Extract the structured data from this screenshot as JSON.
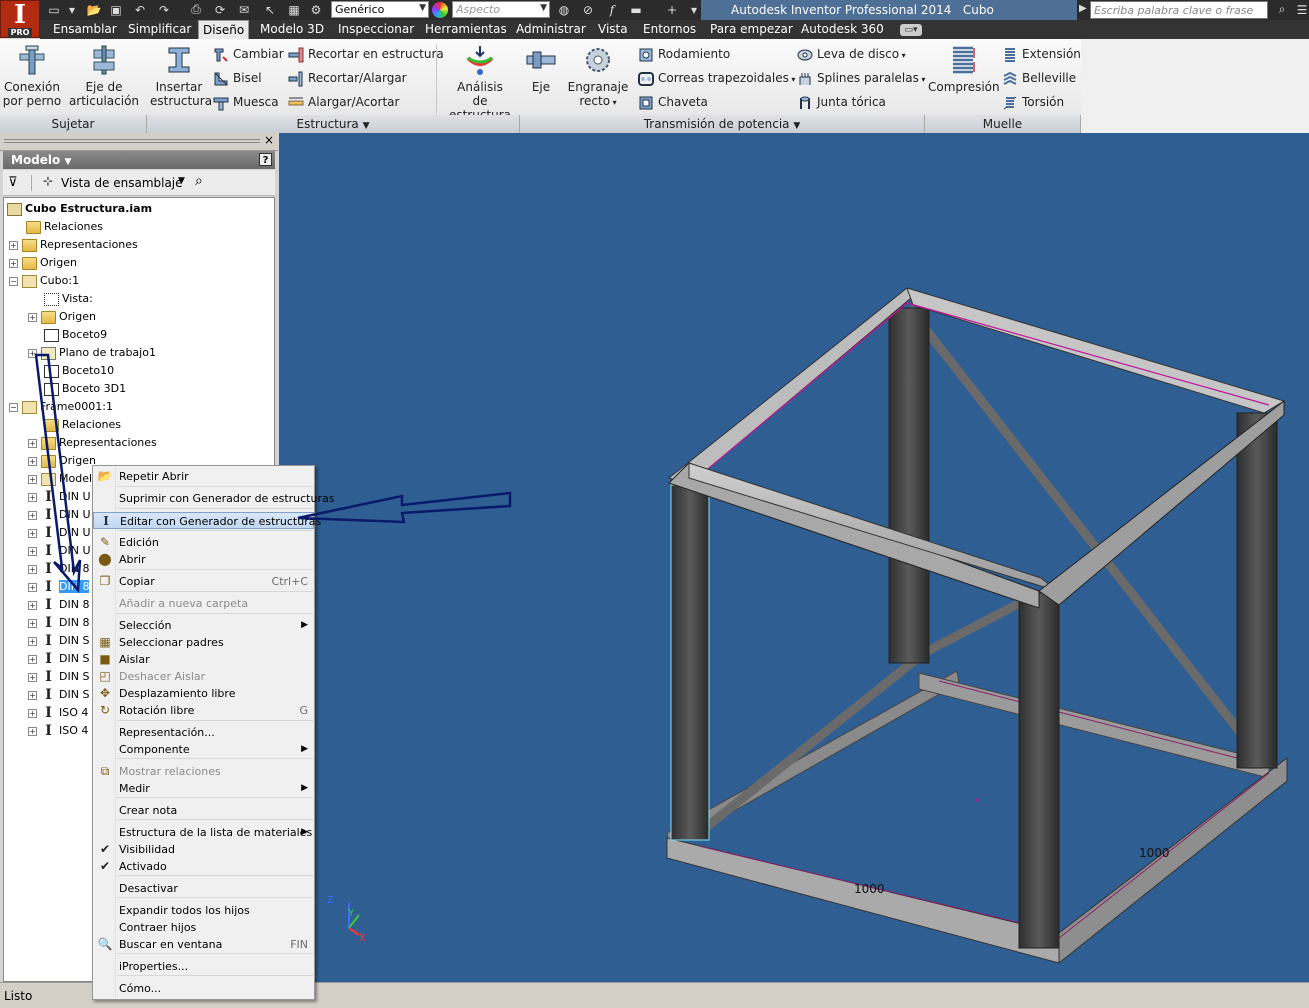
{
  "app": {
    "logo_label": "PRO",
    "window_title": "Autodesk Inventor Professional 2014",
    "document_title": "Cubo Estructura.iam",
    "search_placeholder": "Escriba palabra clave o frase"
  },
  "quick_access": {
    "material_combo": "Genérico",
    "appearance_combo": "Aspecto"
  },
  "menu": {
    "items": [
      "Ensamblar",
      "Simplificar",
      "Diseño",
      "Modelo 3D",
      "Inspeccionar",
      "Herramientas",
      "Administrar",
      "Vista",
      "Entornos",
      "Para empezar",
      "Autodesk 360"
    ],
    "active": "Diseño"
  },
  "ribbon": {
    "panels": {
      "sujetar": "Sujetar",
      "estructura": "Estructura",
      "transmision": "Transmisión de potencia",
      "muelle": "Muelle"
    },
    "sujetar": {
      "conexion_l1": "Conexión",
      "conexion_l2": "por perno",
      "eje_l1": "Eje de",
      "eje_l2": "articulación"
    },
    "estructura": {
      "insertar_l1": "Insertar",
      "insertar_l2": "estructura",
      "cambiar": "Cambiar",
      "bisel": "Bisel",
      "muesca": "Muesca",
      "recortar_estructura": "Recortar en estructura",
      "recortar_alargar": "Recortar/Alargar",
      "alargar_acortar": "Alargar/Acortar",
      "analisis_l1": "Análisis",
      "analisis_l2": "de estructura"
    },
    "transmision": {
      "eje": "Eje",
      "engranaje_l1": "Engranaje",
      "engranaje_l2": "recto",
      "rodamiento": "Rodamiento",
      "correas": "Correas trapezoidales",
      "chaveta": "Chaveta",
      "leva": "Leva de disco",
      "splines": "Splines paralelas",
      "junta": "Junta tórica"
    },
    "muelle": {
      "compresion": "Compresión",
      "extension": "Extensión",
      "belleville": "Belleville",
      "torsion": "Torsión"
    }
  },
  "browser": {
    "title": "Modelo",
    "help": "?",
    "view_combo": "Vista de ensamblaje",
    "tree": [
      {
        "label": "Cubo Estructura.iam"
      },
      {
        "label": "Relaciones"
      },
      {
        "label": "Representaciones"
      },
      {
        "label": "Origen"
      },
      {
        "label": "Cubo:1"
      },
      {
        "label": "Vista:"
      },
      {
        "label": "Origen"
      },
      {
        "label": "Boceto9"
      },
      {
        "label": "Plano de trabajo1"
      },
      {
        "label": "Boceto10"
      },
      {
        "label": "Boceto 3D1"
      },
      {
        "label": "Frame0001:1"
      },
      {
        "label": "Relaciones"
      },
      {
        "label": "Representaciones"
      },
      {
        "label": "Origen"
      },
      {
        "label": "Model"
      },
      {
        "label": "DIN U"
      },
      {
        "label": "DIN U"
      },
      {
        "label": "DIN U"
      },
      {
        "label": "DIN U"
      },
      {
        "label": "DIN 8"
      },
      {
        "label": "DIN 8"
      },
      {
        "label": "DIN 8"
      },
      {
        "label": "DIN 8"
      },
      {
        "label": "DIN S"
      },
      {
        "label": "DIN S"
      },
      {
        "label": "DIN S"
      },
      {
        "label": "DIN S"
      },
      {
        "label": "ISO 4"
      },
      {
        "label": "ISO 4"
      }
    ]
  },
  "context_menu": {
    "items": [
      {
        "label": "Repetir Abrir"
      },
      {
        "label": "Suprimir con Generador de estructuras"
      },
      {
        "label": "Editar con Generador de estructuras"
      },
      {
        "label": "Edición"
      },
      {
        "label": "Abrir"
      },
      {
        "label": "Copiar",
        "shortcut": "Ctrl+C"
      },
      {
        "label": "Añadir a nueva carpeta"
      },
      {
        "label": "Selección"
      },
      {
        "label": "Seleccionar padres"
      },
      {
        "label": "Aislar"
      },
      {
        "label": "Deshacer Aislar"
      },
      {
        "label": "Desplazamiento libre"
      },
      {
        "label": "Rotación libre",
        "shortcut": "G"
      },
      {
        "label": "Representación..."
      },
      {
        "label": "Componente"
      },
      {
        "label": "Mostrar relaciones"
      },
      {
        "label": "Medir"
      },
      {
        "label": "Crear nota"
      },
      {
        "label": "Estructura de la lista de materiales"
      },
      {
        "label": "Visibilidad"
      },
      {
        "label": "Activado"
      },
      {
        "label": "Desactivar"
      },
      {
        "label": "Expandir todos los hijos"
      },
      {
        "label": "Contraer hijos"
      },
      {
        "label": "Buscar en ventana",
        "shortcut": "FIN"
      },
      {
        "label": "iProperties..."
      },
      {
        "label": "Cómo..."
      }
    ]
  },
  "viewport": {
    "dimension_front": "1000",
    "dimension_right": "1000",
    "axis_x": "X",
    "axis_y": "Y",
    "axis_z": "Z"
  },
  "status": {
    "text": "Listo"
  },
  "colors": {
    "viewport_bg": "#2f5e93",
    "member_dark": "#4a4a4a",
    "member_light": "#bdbdbd",
    "highlight_magenta": "#c0169a",
    "selection_blue": "#3399ff",
    "annotation_arrow": "#0a1a6a"
  }
}
